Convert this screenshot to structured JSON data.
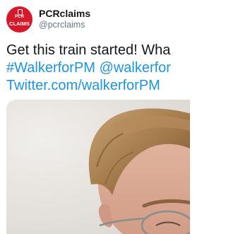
{
  "profile": {
    "display_name": "PCRclaims",
    "handle": "@pcrclaims",
    "avatar_text_top": "PCR",
    "avatar_text_bottom": "CLAIMS",
    "avatar_color": "#d6182a"
  },
  "tweet": {
    "text_line1": "Get this train started! Wha",
    "hashtag": "#WalkerforPM",
    "mention": "@walkerfor",
    "url": "Twitter.com/walkerforPM",
    "link_color": "#1b95e0"
  },
  "media": {
    "alt": "photo of a man with glasses"
  }
}
